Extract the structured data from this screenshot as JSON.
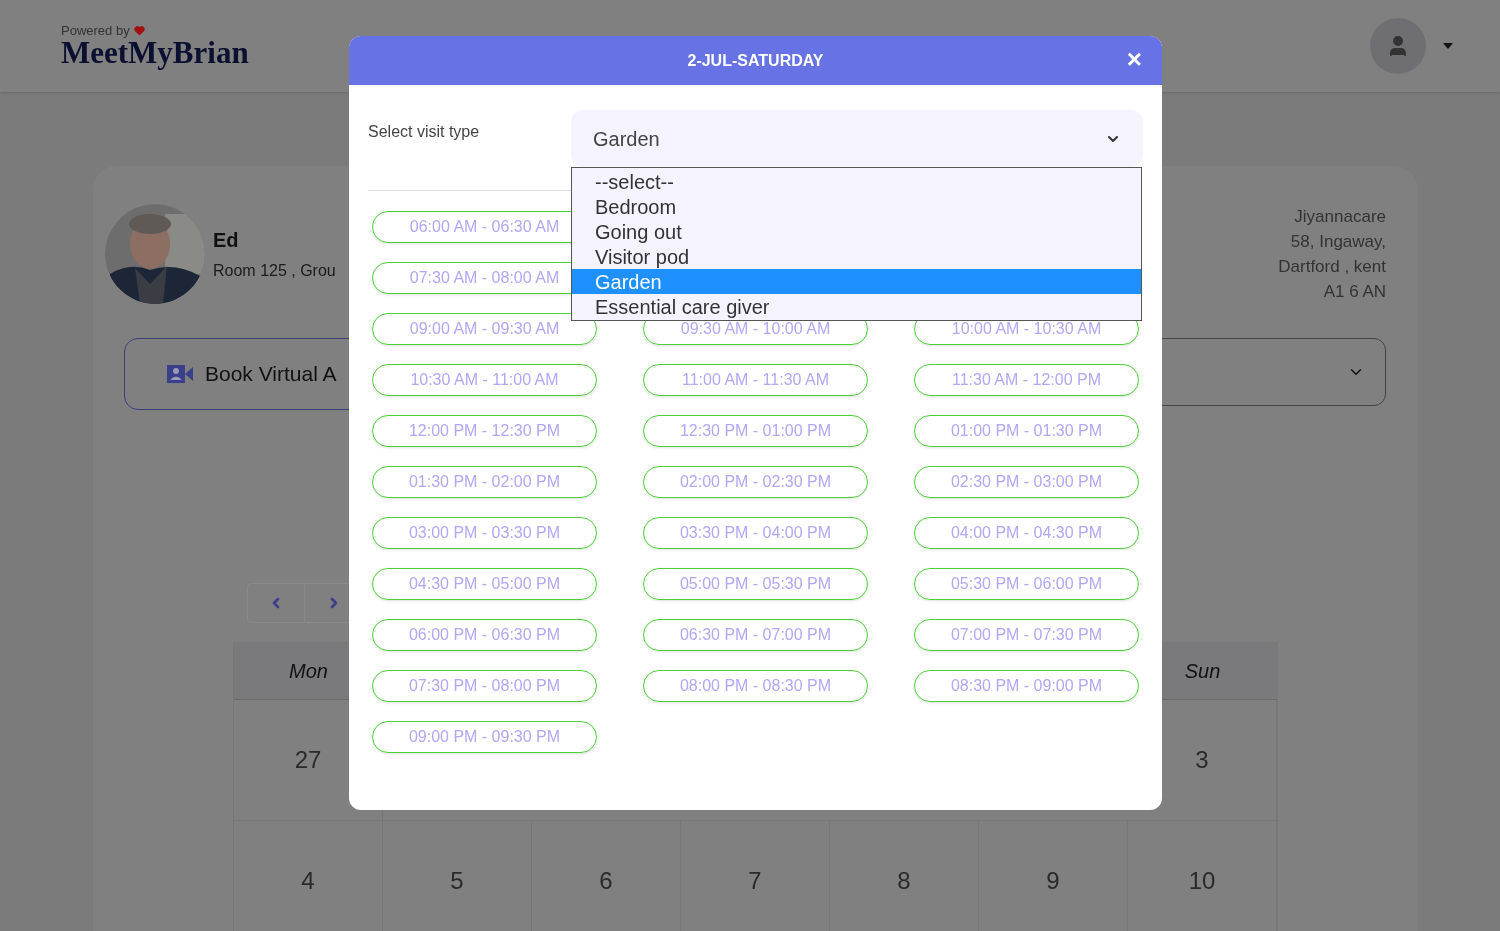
{
  "header": {
    "powered_by": "Powered by",
    "logo": "MeetMyBrian"
  },
  "resident": {
    "name": "Ed",
    "room": "Room 125 , Grou",
    "address": [
      "Jiyannacare",
      "58, Ingaway,",
      "Dartford , kent",
      "A1 6 AN"
    ]
  },
  "book_button": {
    "label": "Book Virtual A"
  },
  "calendar": {
    "header": [
      {
        "label": "Mon"
      },
      {
        "label": "Sun"
      }
    ],
    "weeks": [
      [
        "27",
        "3"
      ],
      [
        "4",
        "5",
        "6",
        "7",
        "8",
        "9",
        "10"
      ]
    ]
  },
  "modal": {
    "title": "2-JUL-SATURDAY",
    "close": "×",
    "visit_type_label": "Select visit type",
    "visit_type_value": "Garden",
    "options": [
      {
        "label": "--select--",
        "selected": false
      },
      {
        "label": "Bedroom",
        "selected": false
      },
      {
        "label": "Going out",
        "selected": false
      },
      {
        "label": "Visitor pod",
        "selected": false
      },
      {
        "label": "Garden",
        "selected": true
      },
      {
        "label": "Essential care giver",
        "selected": false
      }
    ],
    "slot_rows": [
      [
        "06:00 AM - 06:30 AM"
      ],
      [
        "07:30 AM - 08:00 AM"
      ],
      [
        "09:00 AM - 09:30 AM",
        "09:30 AM - 10:00 AM",
        "10:00 AM - 10:30 AM"
      ],
      [
        "10:30 AM - 11:00 AM",
        "11:00 AM - 11:30 AM",
        "11:30 AM - 12:00 PM"
      ],
      [
        "12:00 PM - 12:30 PM",
        "12:30 PM - 01:00 PM",
        "01:00 PM - 01:30 PM"
      ],
      [
        "01:30 PM - 02:00 PM",
        "02:00 PM - 02:30 PM",
        "02:30 PM - 03:00 PM"
      ],
      [
        "03:00 PM - 03:30 PM",
        "03:30 PM - 04:00 PM",
        "04:00 PM - 04:30 PM"
      ],
      [
        "04:30 PM - 05:00 PM",
        "05:00 PM - 05:30 PM",
        "05:30 PM - 06:00 PM"
      ],
      [
        "06:00 PM - 06:30 PM",
        "06:30 PM - 07:00 PM",
        "07:00 PM - 07:30 PM"
      ],
      [
        "07:30 PM - 08:00 PM",
        "08:00 PM - 08:30 PM",
        "08:30 PM - 09:00 PM"
      ],
      [
        "09:00 PM - 09:30 PM"
      ]
    ]
  }
}
